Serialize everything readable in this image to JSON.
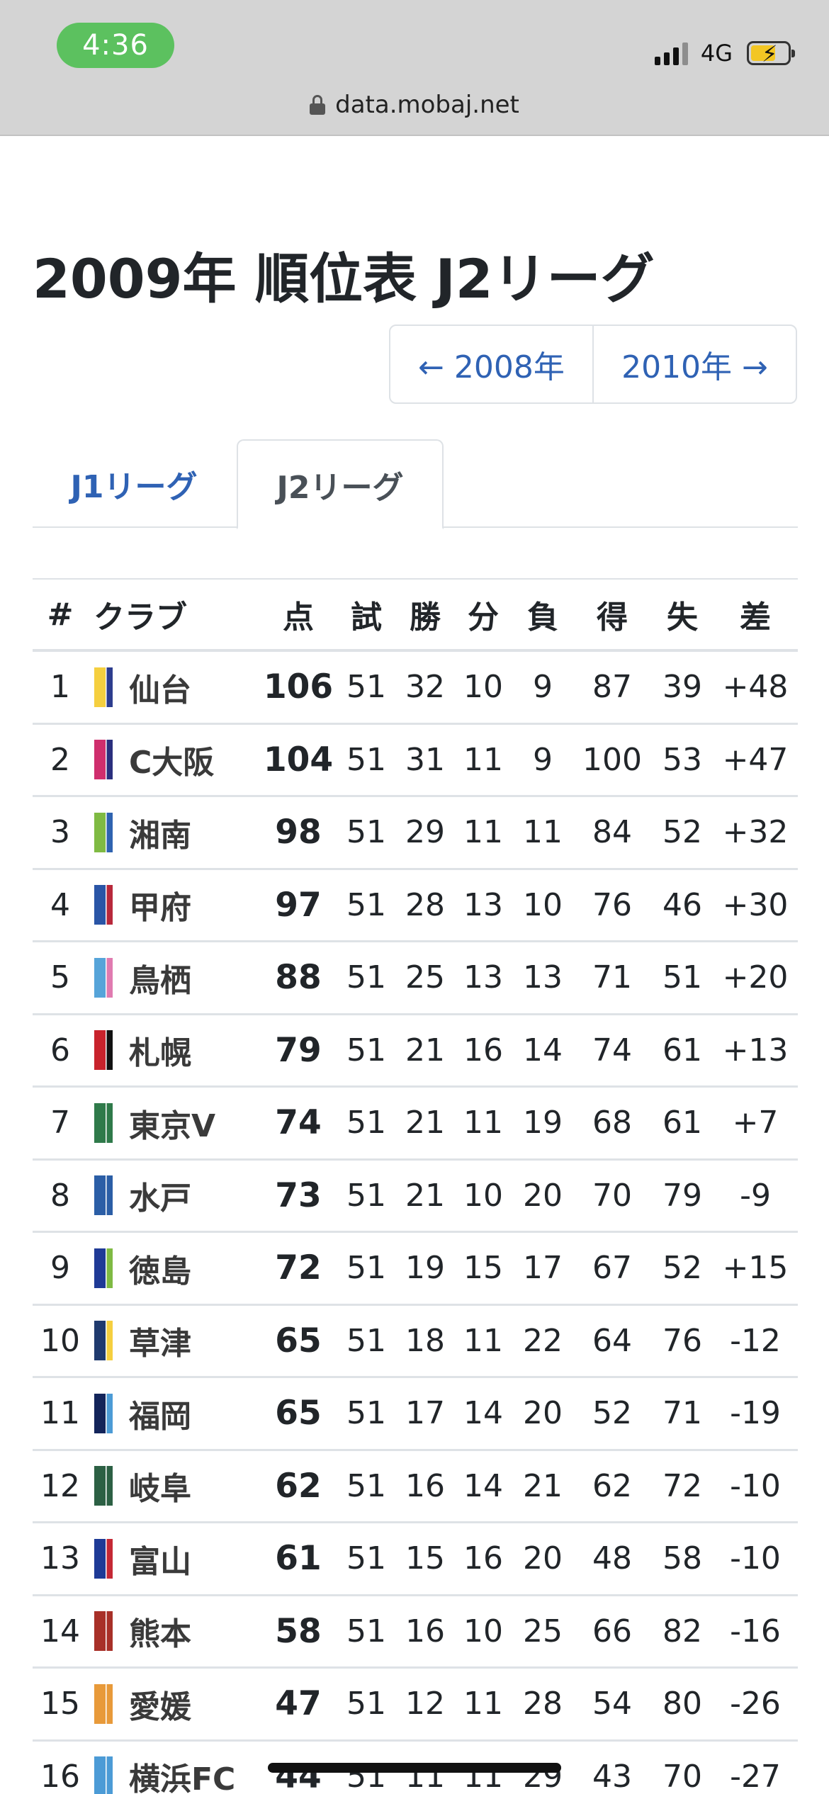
{
  "status_bar": {
    "time": "4:36",
    "network": "4G"
  },
  "url_bar": {
    "domain": "data.mobaj.net"
  },
  "page": {
    "title": "2009年 順位表 J2リーグ"
  },
  "year_nav": {
    "prev_label": "← 2008年",
    "next_label": "2010年 →"
  },
  "tabs": [
    {
      "label": "J1リーグ",
      "active": false
    },
    {
      "label": "J2リーグ",
      "active": true
    }
  ],
  "table": {
    "headers": {
      "rank": "#",
      "club": "クラブ",
      "pts": "点",
      "gp": "試",
      "w": "勝",
      "d": "分",
      "l": "負",
      "gf": "得",
      "ga": "失",
      "gd": "差"
    },
    "rows": [
      {
        "rank": "1",
        "club": "仙台",
        "pts": "106",
        "gp": "51",
        "w": "32",
        "d": "10",
        "l": "9",
        "gf": "87",
        "ga": "39",
        "gd": "+48",
        "colors": [
          "#f5cf3f",
          "#2d3d8e"
        ]
      },
      {
        "rank": "2",
        "club": "C大阪",
        "pts": "104",
        "gp": "51",
        "w": "31",
        "d": "11",
        "l": "9",
        "gf": "100",
        "ga": "53",
        "gd": "+47",
        "colors": [
          "#cf2e6d",
          "#2a2f7e"
        ]
      },
      {
        "rank": "3",
        "club": "湘南",
        "pts": "98",
        "gp": "51",
        "w": "29",
        "d": "11",
        "l": "11",
        "gf": "84",
        "ga": "52",
        "gd": "+32",
        "colors": [
          "#7fba43",
          "#2f63b0"
        ]
      },
      {
        "rank": "4",
        "club": "甲府",
        "pts": "97",
        "gp": "51",
        "w": "28",
        "d": "13",
        "l": "10",
        "gf": "76",
        "ga": "46",
        "gd": "+30",
        "colors": [
          "#2a55a6",
          "#b8283b"
        ]
      },
      {
        "rank": "5",
        "club": "鳥栖",
        "pts": "88",
        "gp": "51",
        "w": "25",
        "d": "13",
        "l": "13",
        "gf": "71",
        "ga": "51",
        "gd": "+20",
        "colors": [
          "#56a4d9",
          "#e07bb0"
        ]
      },
      {
        "rank": "6",
        "club": "札幌",
        "pts": "79",
        "gp": "51",
        "w": "21",
        "d": "16",
        "l": "14",
        "gf": "74",
        "ga": "61",
        "gd": "+13",
        "colors": [
          "#c8232c",
          "#111111"
        ]
      },
      {
        "rank": "7",
        "club": "東京V",
        "pts": "74",
        "gp": "51",
        "w": "21",
        "d": "11",
        "l": "19",
        "gf": "68",
        "ga": "61",
        "gd": "+7",
        "colors": [
          "#2f7a4a",
          "#2f7a4a"
        ]
      },
      {
        "rank": "8",
        "club": "水戸",
        "pts": "73",
        "gp": "51",
        "w": "21",
        "d": "10",
        "l": "20",
        "gf": "70",
        "ga": "79",
        "gd": "-9",
        "colors": [
          "#2b5ea6",
          "#2b5ea6"
        ]
      },
      {
        "rank": "9",
        "club": "徳島",
        "pts": "72",
        "gp": "51",
        "w": "19",
        "d": "15",
        "l": "17",
        "gf": "67",
        "ga": "52",
        "gd": "+15",
        "colors": [
          "#1f3a96",
          "#7fba43"
        ]
      },
      {
        "rank": "10",
        "club": "草津",
        "pts": "65",
        "gp": "51",
        "w": "18",
        "d": "11",
        "l": "22",
        "gf": "64",
        "ga": "76",
        "gd": "-12",
        "colors": [
          "#1f3a6e",
          "#f5cf3f"
        ]
      },
      {
        "rank": "11",
        "club": "福岡",
        "pts": "65",
        "gp": "51",
        "w": "17",
        "d": "14",
        "l": "20",
        "gf": "52",
        "ga": "71",
        "gd": "-19",
        "colors": [
          "#13245a",
          "#4c9bd6"
        ]
      },
      {
        "rank": "12",
        "club": "岐阜",
        "pts": "62",
        "gp": "51",
        "w": "16",
        "d": "14",
        "l": "21",
        "gf": "62",
        "ga": "72",
        "gd": "-10",
        "colors": [
          "#2c6044",
          "#2c6044"
        ]
      },
      {
        "rank": "13",
        "club": "富山",
        "pts": "61",
        "gp": "51",
        "w": "15",
        "d": "16",
        "l": "20",
        "gf": "48",
        "ga": "58",
        "gd": "-10",
        "colors": [
          "#1e3a96",
          "#c52835"
        ]
      },
      {
        "rank": "14",
        "club": "熊本",
        "pts": "58",
        "gp": "51",
        "w": "16",
        "d": "10",
        "l": "25",
        "gf": "66",
        "ga": "82",
        "gd": "-16",
        "colors": [
          "#a83028",
          "#a83028"
        ]
      },
      {
        "rank": "15",
        "club": "愛媛",
        "pts": "47",
        "gp": "51",
        "w": "12",
        "d": "11",
        "l": "28",
        "gf": "54",
        "ga": "80",
        "gd": "-26",
        "colors": [
          "#e89a3a",
          "#e89a3a"
        ]
      },
      {
        "rank": "16",
        "club": "横浜FC",
        "pts": "44",
        "gp": "51",
        "w": "11",
        "d": "11",
        "l": "29",
        "gf": "43",
        "ga": "70",
        "gd": "-27",
        "colors": [
          "#4c9bd6",
          "#4c9bd6"
        ]
      }
    ]
  }
}
